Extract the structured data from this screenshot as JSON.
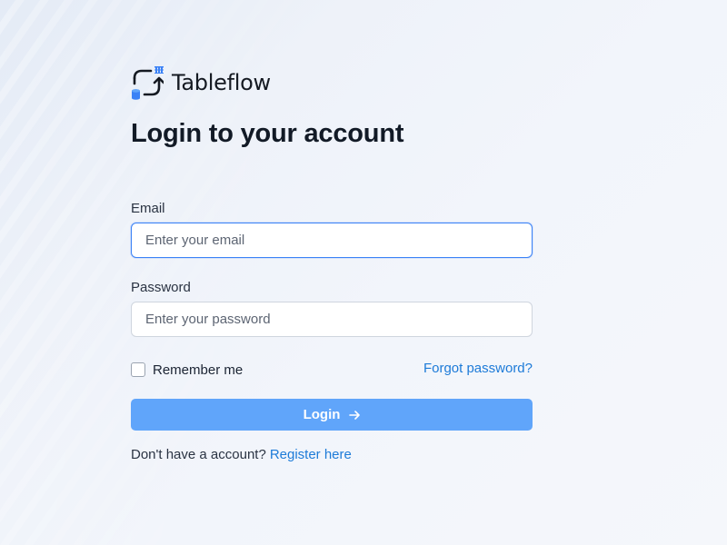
{
  "brand": {
    "name": "Tableflow",
    "logo_icon": "tableflow-logo-icon",
    "accent_color": "#3b82f6"
  },
  "login": {
    "title": "Login to your account",
    "email_label": "Email",
    "email_placeholder": "Enter your email",
    "email_value": "",
    "password_label": "Password",
    "password_placeholder": "Enter your password",
    "password_value": "",
    "remember_label": "Remember me",
    "remember_checked": false,
    "forgot_link": "Forgot password?",
    "submit_label": "Login",
    "submit_icon": "arrow-right-icon",
    "button_color": "#60a5fa",
    "link_color": "#1d7bd8",
    "no_account_text": "Don't have a account?",
    "register_link": "Register here"
  }
}
